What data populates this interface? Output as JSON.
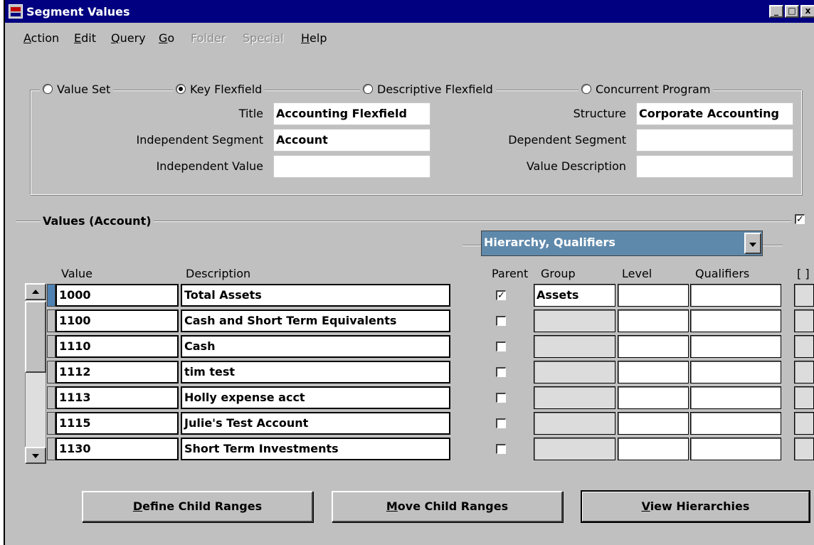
{
  "window": {
    "title": "Segment Values",
    "minimize_glyph": "_",
    "maximize_glyph": "□",
    "close_glyph": "x"
  },
  "menu": [
    {
      "prefix": "",
      "mnemonic": "A",
      "rest": "ction",
      "enabled": true
    },
    {
      "prefix": "",
      "mnemonic": "E",
      "rest": "dit",
      "enabled": true
    },
    {
      "prefix": "",
      "mnemonic": "Q",
      "rest": "uery",
      "enabled": true
    },
    {
      "prefix": "",
      "mnemonic": "G",
      "rest": "o",
      "enabled": true
    },
    {
      "prefix": "Folder",
      "mnemonic": "",
      "rest": "",
      "enabled": false
    },
    {
      "prefix": "Special",
      "mnemonic": "",
      "rest": "",
      "enabled": false
    },
    {
      "prefix": "",
      "mnemonic": "H",
      "rest": "elp",
      "enabled": true
    }
  ],
  "type_options": [
    {
      "label": "Value Set",
      "selected": false
    },
    {
      "label": "Key Flexfield",
      "selected": true
    },
    {
      "label": "Descriptive Flexfield",
      "selected": false
    },
    {
      "label": "Concurrent Program",
      "selected": false
    }
  ],
  "form": {
    "title_label": "Title",
    "title_value": "Accounting Flexfield",
    "structure_label": "Structure",
    "structure_value": "Corporate Accounting",
    "indep_segment_label": "Independent Segment",
    "indep_segment_value": "Account",
    "dep_segment_label": "Dependent Segment",
    "dep_segment_value": "",
    "indep_value_label": "Independent Value",
    "indep_value_value": "",
    "value_desc_label": "Value Description",
    "value_desc_value": ""
  },
  "values_section": {
    "title": "Values (Account)",
    "show_checkbox_checked": true,
    "region_selected": "Hierarchy, Qualifiers",
    "columns": {
      "value": "Value",
      "description": "Description",
      "parent": "Parent",
      "group": "Group",
      "level": "Level",
      "qualifiers": "Qualifiers",
      "dff": "[ ]"
    },
    "rows": [
      {
        "value": "1000",
        "description": "Total Assets",
        "parent": true,
        "group": "Assets"
      },
      {
        "value": "1100",
        "description": "Cash and Short Term Equivalents",
        "parent": false,
        "group": ""
      },
      {
        "value": "1110",
        "description": "Cash",
        "parent": false,
        "group": ""
      },
      {
        "value": "1112",
        "description": "tim test",
        "parent": false,
        "group": ""
      },
      {
        "value": "1113",
        "description": "Holly expense acct",
        "parent": false,
        "group": ""
      },
      {
        "value": "1115",
        "description": "Julie's Test Account",
        "parent": false,
        "group": ""
      },
      {
        "value": "1130",
        "description": "Short Term Investments",
        "parent": false,
        "group": ""
      }
    ]
  },
  "buttons": {
    "define": {
      "mnemonic": "D",
      "rest": "efine Child Ranges"
    },
    "move": {
      "mnemonic": "M",
      "rest": "ove Child Ranges"
    },
    "view": {
      "mnemonic": "V",
      "rest": "iew Hierarchies"
    }
  },
  "icons": {
    "window_icon": "oracle-forms-icon",
    "check_glyph": "✓"
  }
}
